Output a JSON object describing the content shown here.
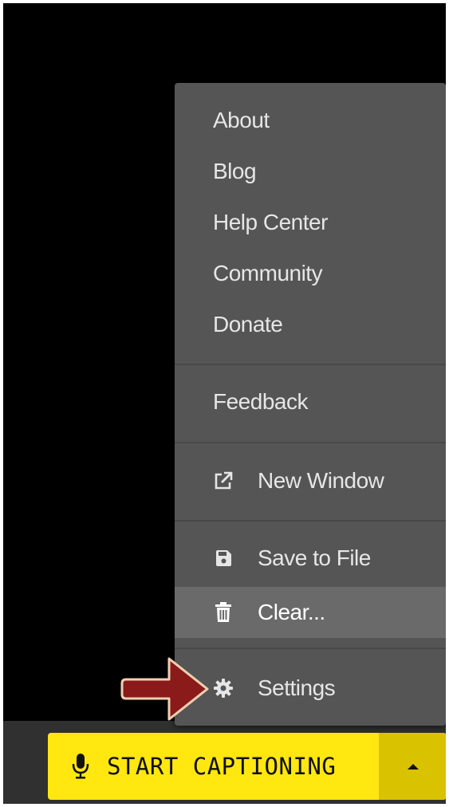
{
  "menu": {
    "items": [
      {
        "label": "About",
        "icon": ""
      },
      {
        "label": "Blog",
        "icon": ""
      },
      {
        "label": "Help Center",
        "icon": ""
      },
      {
        "label": "Community",
        "icon": ""
      },
      {
        "label": "Donate",
        "icon": ""
      },
      {
        "label": "Feedback",
        "icon": ""
      },
      {
        "label": "New Window",
        "icon": "external-link-icon"
      },
      {
        "label": "Save to File",
        "icon": "floppy-disk-icon"
      },
      {
        "label": "Clear...",
        "icon": "trash-icon"
      },
      {
        "label": "Settings",
        "icon": "gear-icon"
      }
    ],
    "highlighted": "Clear..."
  },
  "caption_button": {
    "label": "START CAPTIONING",
    "icon": "microphone-icon",
    "dropdown_icon": "caret-up-icon"
  },
  "annotation": {
    "icon": "red-arrow-icon",
    "points_to": "Settings"
  },
  "colors": {
    "background": "#000000",
    "menu_bg": "#555555",
    "menu_highlight": "#6a6a6a",
    "menu_text": "#e6e6e6",
    "button_yellow": "#ffe70f",
    "button_yellow_dark": "#d9c200",
    "arrow_red": "#8b1a1a"
  }
}
